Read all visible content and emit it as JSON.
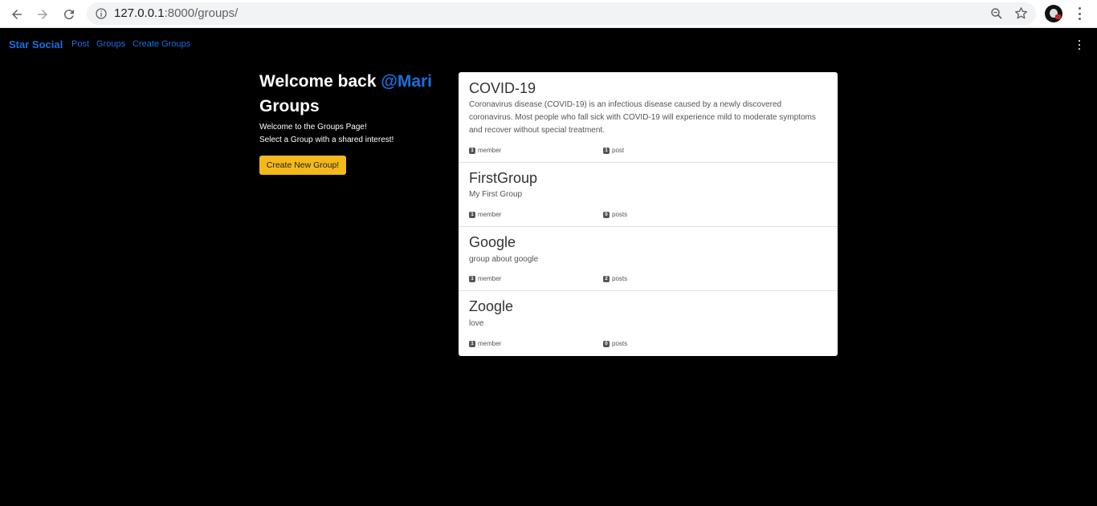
{
  "browser": {
    "url_host": "127.0.0.1",
    "url_path": ":8000/groups/"
  },
  "navbar": {
    "brand": "Star Social",
    "links": [
      "Post",
      "Groups",
      "Create Groups"
    ]
  },
  "intro": {
    "welcome_prefix": "Welcome back",
    "username": "@Mari",
    "title": "Groups",
    "line1": "Welcome to the Groups Page!",
    "line2": "Select a Group with a shared interest!",
    "create_button": "Create New Group!"
  },
  "groups": [
    {
      "name": "COVID-19",
      "description": "Coronavirus disease (COVID-19) is an infectious disease caused by a newly discovered coronavirus. Most people who fall sick with COVID-19 will experience mild to moderate symptoms and recover without special treatment.",
      "members": "1",
      "members_label": "member",
      "posts": "1",
      "posts_label": "post"
    },
    {
      "name": "FirstGroup",
      "description": "My First Group",
      "members": "1",
      "members_label": "member",
      "posts": "0",
      "posts_label": "posts"
    },
    {
      "name": "Google",
      "description": "group about google",
      "members": "1",
      "members_label": "member",
      "posts": "2",
      "posts_label": "posts"
    },
    {
      "name": "Zoogle",
      "description": "love",
      "members": "1",
      "members_label": "member",
      "posts": "0",
      "posts_label": "posts"
    }
  ],
  "colors": {
    "accent": "#1a6fe0",
    "button": "#f3b91a",
    "background": "#000000"
  }
}
